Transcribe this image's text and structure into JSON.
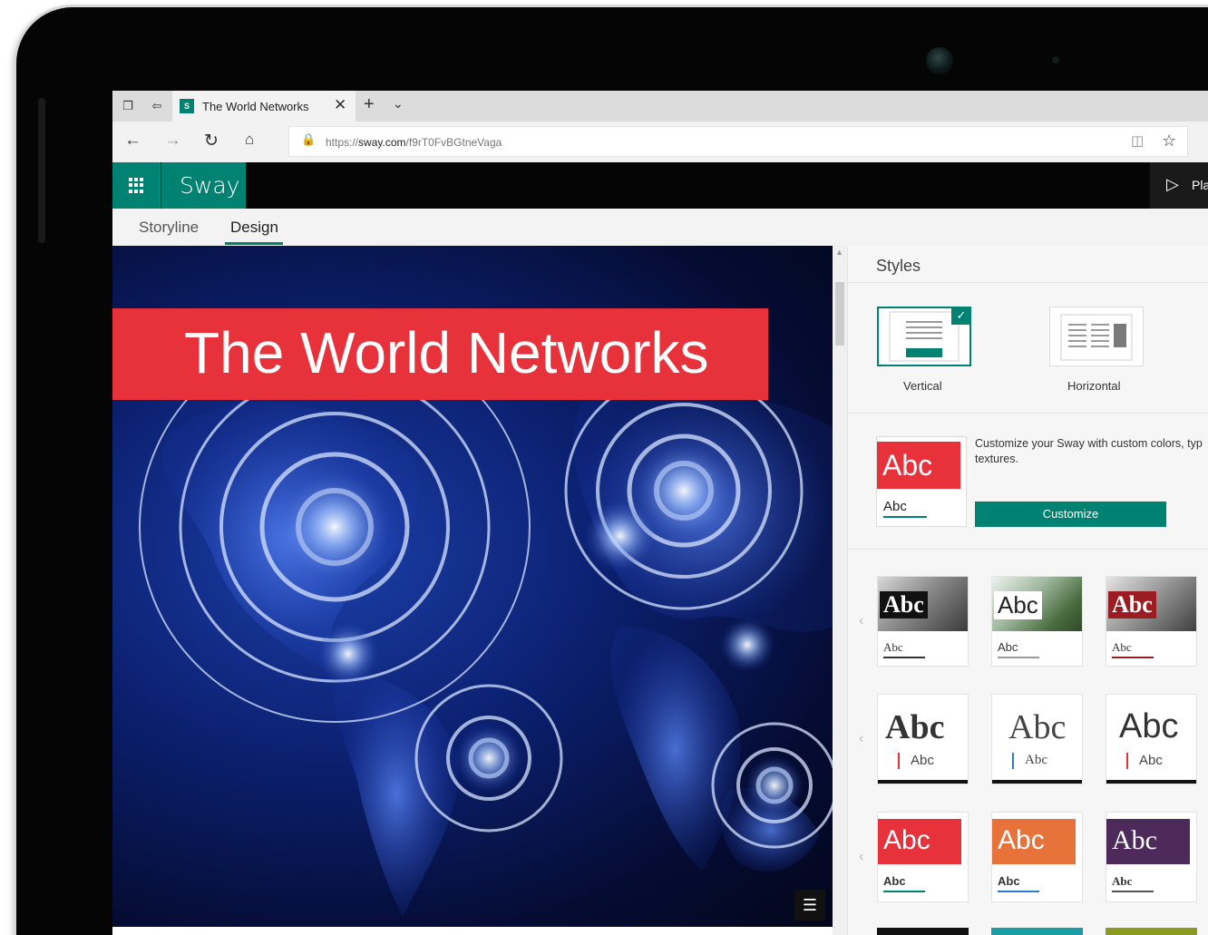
{
  "browser": {
    "tab_title": "The World Networks",
    "url_prefix": "https://",
    "url_domain": "sway.com",
    "url_path": "/f9rT0FvBGtneVaga"
  },
  "app": {
    "brand": "Sway",
    "play_label": "Pla",
    "tabs": [
      {
        "label": "Storyline"
      },
      {
        "label": "Design"
      }
    ]
  },
  "canvas": {
    "title": "The World Networks"
  },
  "pane": {
    "title": "Styles",
    "layouts": [
      {
        "label": "Vertical"
      },
      {
        "label": "Horizontal"
      }
    ],
    "customize": {
      "sample_big": "Abc",
      "sample_small": "Abc",
      "text": "Customize your Sway with custom colors, typ textures.",
      "button": "Customize"
    },
    "themes": [
      {
        "big": "Abc",
        "small": "Abc"
      },
      {
        "big": "Abc",
        "small": "Abc"
      },
      {
        "big": "Abc",
        "small": "Abc"
      },
      {
        "big": "Abc",
        "small": "Abc"
      },
      {
        "big": "Abc",
        "small": "Abc"
      },
      {
        "big": "Abc",
        "small": "Abc"
      },
      {
        "big": "Abc",
        "small": "Abc"
      },
      {
        "big": "Abc",
        "small": "Abc"
      },
      {
        "big": "Abc",
        "small": "Abc"
      }
    ]
  },
  "colors": {
    "accent": "#008272",
    "title_band": "#e8323b"
  }
}
